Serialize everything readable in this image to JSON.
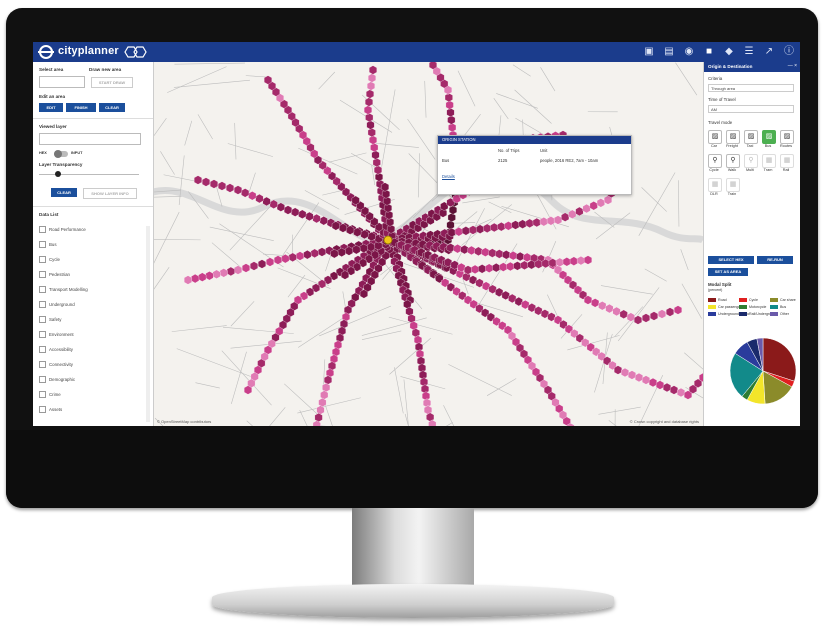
{
  "app": {
    "title": "cityplanner"
  },
  "toolbar": {
    "icons": [
      "map-icon",
      "chart-icon",
      "origin-destination-icon",
      "car-icon",
      "layers-icon",
      "list-icon",
      "export-icon",
      "info-icon"
    ]
  },
  "left_panel": {
    "select_area": "Select area",
    "draw_area": "Draw new area",
    "draw_btn": "START DRAW",
    "edit_area": "Edit an area",
    "edit_btn": "EDIT",
    "finish_btn": "FINISH",
    "clear_btn": "CLEAR",
    "viewed_layer": "Viewed layer",
    "hex": "HEX",
    "input": "INPUT",
    "transparency": "Layer Transparency",
    "clear2": "CLEAR",
    "show_layer": "SHOW LAYER INFO",
    "data_list_title": "Data List",
    "data_list": [
      "Road Performance",
      "Bus",
      "Cycle",
      "Pedestrian",
      "Transport Modelling",
      "Underground",
      "Safety",
      "Environment",
      "Accessibility",
      "Connectivity",
      "Demographic",
      "Crime",
      "Assets"
    ]
  },
  "popup": {
    "title": "ORIGIN STATION",
    "col1": "No. of Trips",
    "col2": "Unit",
    "row_label": "Bus",
    "row_value": "2125",
    "row_unit": "people, 2016 RE2, 7am - 10am",
    "link": "Details"
  },
  "right_panel": {
    "title": "Origin & Destination",
    "criteria": "Criteria",
    "criteria_value": "Through area",
    "time": "Time of Travel",
    "time_value": "AM",
    "travel_mode": "Travel mode",
    "modes": [
      "Car",
      "Freight",
      "Taxi",
      "Bus",
      "Routes",
      "Cycle",
      "Walk",
      "Multi",
      "Tram",
      "Rail",
      "DLR",
      "Train"
    ],
    "select_hex": "SELECT HEX",
    "re_run": "RE-RUN",
    "set_area": "SET AS AREA",
    "modal_split": "Modal Split",
    "modal_sub": "(percent)",
    "legend": [
      {
        "name": "Road",
        "color": "#8b1a1a"
      },
      {
        "name": "Cycle",
        "color": "#e02020"
      },
      {
        "name": "Car share",
        "color": "#8b8b2a"
      },
      {
        "name": "Car passenger",
        "color": "#f3e52a"
      },
      {
        "name": "Motorcycle",
        "color": "#2e7d32"
      },
      {
        "name": "Bus",
        "color": "#128a8a"
      },
      {
        "name": "Underground/Metro",
        "color": "#2a3c9c"
      },
      {
        "name": "Rail/Underground",
        "color": "#1a2a6c"
      },
      {
        "name": "Other",
        "color": "#6a5aaa"
      }
    ]
  },
  "chart_data": {
    "type": "pie",
    "title": "",
    "slices": [
      {
        "color": "#8b1a1a",
        "value": 30
      },
      {
        "color": "#e02020",
        "value": 3
      },
      {
        "color": "#8b8b2a",
        "value": 16
      },
      {
        "color": "#f3e52a",
        "value": 9
      },
      {
        "color": "#2e7d32",
        "value": 3
      },
      {
        "color": "#128a8a",
        "value": 23
      },
      {
        "color": "#2a3c9c",
        "value": 8
      },
      {
        "color": "#1a2a6c",
        "value": 5
      },
      {
        "color": "#6a5aaa",
        "value": 3
      }
    ]
  },
  "map": {
    "credit_left": "© OpenStreetMap contributors",
    "credit_right": "© Crown copyright and database rights"
  }
}
